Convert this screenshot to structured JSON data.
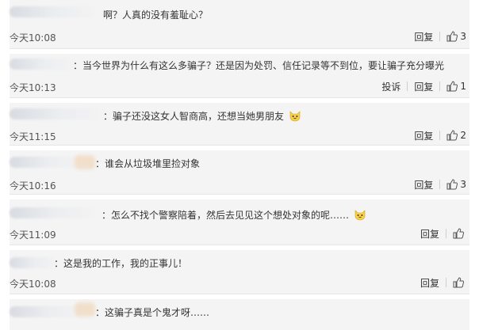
{
  "comments": [
    {
      "text": "啊？人真的没有羞耻心？",
      "time": "今天10:08",
      "actions": {
        "reply": "回复",
        "like_count": "3"
      }
    },
    {
      "text": "：当今世界为什么有这么多骗子？还是因为处罚、信任记录等不到位，要让骗子充分曝光",
      "time": "今天10:13",
      "actions": {
        "report": "投诉",
        "reply": "回复",
        "like_count": "1"
      }
    },
    {
      "text": "：骗子还没这女人智商高，还想当她男朋友",
      "time": "今天11:15",
      "actions": {
        "reply": "回复",
        "like_count": "2"
      },
      "emoji": "laughing-cat-emoji"
    },
    {
      "text": "：谁会从垃圾堆里捡对象",
      "time": "今天10:16",
      "actions": {
        "reply": "回复",
        "like_count": "3"
      }
    },
    {
      "text": "：怎么不找个警察陪着，然后去见见这个想处对象的呢……",
      "time": "今天11:09",
      "actions": {
        "reply": "回复",
        "like_count": ""
      },
      "emoji": "laughing-cat-emoji"
    },
    {
      "text": "：这是我的工作，我的正事儿！",
      "time": "今天10:08",
      "actions": {
        "reply": "回复",
        "like_count": ""
      }
    },
    {
      "text": "：这骗子真是个鬼才呀……",
      "time": "",
      "actions": {}
    }
  ]
}
